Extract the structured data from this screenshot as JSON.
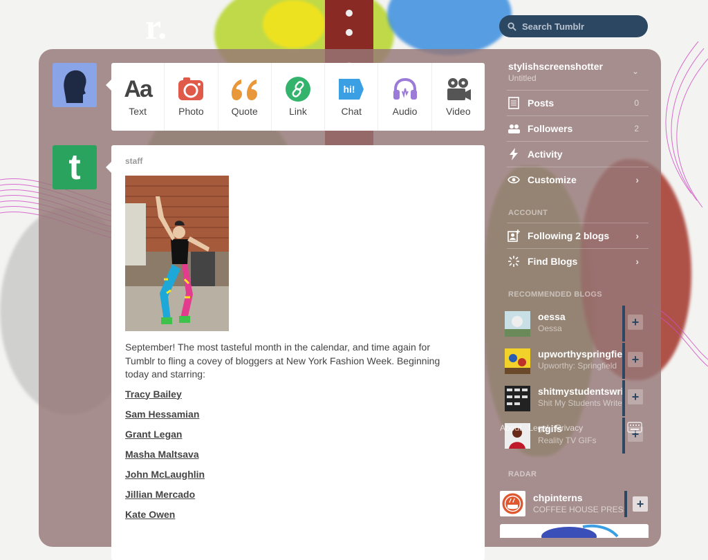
{
  "header": {
    "logo_text": "r.",
    "search_placeholder": "Search Tumblr"
  },
  "post_types": [
    {
      "label": "Text",
      "icon": "text-icon",
      "glyph": "Aa"
    },
    {
      "label": "Photo",
      "icon": "camera-icon"
    },
    {
      "label": "Quote",
      "icon": "quote-icon",
      "glyph": "66"
    },
    {
      "label": "Link",
      "icon": "link-icon"
    },
    {
      "label": "Chat",
      "icon": "chat-icon",
      "glyph": "hi!"
    },
    {
      "label": "Audio",
      "icon": "headphones-icon"
    },
    {
      "label": "Video",
      "icon": "video-camera-icon"
    }
  ],
  "post": {
    "author": "staff",
    "body": "September! The most tasteful month in the calendar, and time again for Tumblr to fling a covey of bloggers at New York Fashion Week. Beginning today and starring:",
    "names": [
      "Tracy Bailey",
      "Sam Hessamian",
      "Grant Legan",
      "Masha Maltsava",
      "John McLaughlin",
      "Jillian Mercado",
      "Kate Owen"
    ]
  },
  "sidebar": {
    "blog_name": "stylishscreenshotter",
    "blog_sub": "Untitled",
    "items": [
      {
        "label": "Posts",
        "count": "0",
        "icon": "posts-icon"
      },
      {
        "label": "Followers",
        "count": "2",
        "icon": "followers-icon"
      },
      {
        "label": "Activity",
        "icon": "lightning-icon"
      },
      {
        "label": "Customize",
        "icon": "eye-icon"
      }
    ],
    "account_heading": "ACCOUNT",
    "account_items": [
      {
        "label": "Following 2 blogs",
        "icon": "following-icon"
      },
      {
        "label": "Find Blogs",
        "icon": "find-blogs-icon"
      }
    ],
    "recommended_heading": "RECOMMENDED BLOGS",
    "recommended": [
      {
        "name": "oessa",
        "desc": "Oessa"
      },
      {
        "name": "upworthyspringfield",
        "desc": "Upworthy: Springfield"
      },
      {
        "name": "shitmystudentswrite",
        "desc": "Shit My Students Write"
      },
      {
        "name": "rtgifs",
        "desc": "Reality TV GIFs"
      }
    ],
    "footer_links": [
      "About",
      "Legal",
      "Privacy"
    ],
    "radar_heading": "RADAR",
    "radar": {
      "name": "chpinterns",
      "desc": "COFFEE HOUSE PRESS"
    }
  },
  "colors": {
    "panel": "#967878",
    "search_bg": "#2c4762",
    "staff_green": "#2aa35f",
    "photo_icon": "#e05a4a",
    "quote_icon": "#e8973a",
    "link_icon": "#33b36b",
    "chat_icon": "#3a9fe3",
    "audio_icon": "#9b7ad8",
    "video_icon": "#555555"
  }
}
